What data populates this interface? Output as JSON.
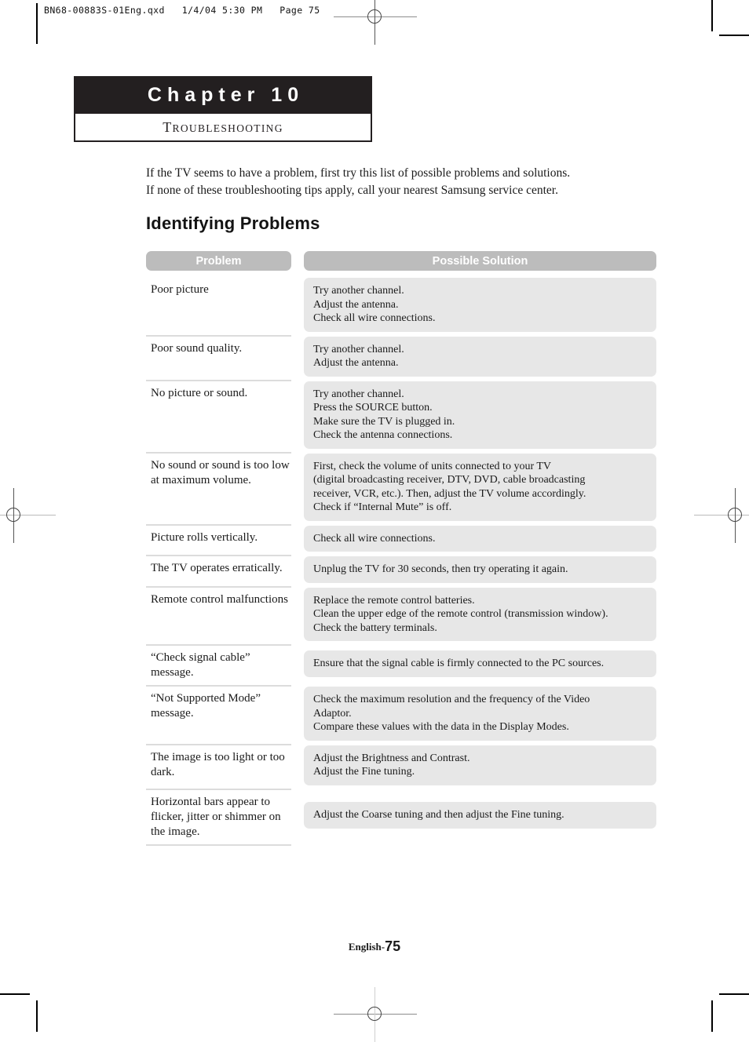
{
  "print_header": {
    "text": "BN68-00883S-01Eng.qxd   1/4/04 5:30 PM   Page 75"
  },
  "chapter": {
    "title": "Chapter 10",
    "subtitle_first_letter": "T",
    "subtitle_rest": "ROUBLESHOOTING"
  },
  "intro": {
    "line1": "If the TV seems to have a problem, first try this list of possible problems and solutions.",
    "line2": "If none of these troubleshooting tips apply, call your nearest Samsung service center."
  },
  "section": {
    "heading": "Identifying Problems"
  },
  "table": {
    "headers": {
      "problem": "Problem",
      "solution": "Possible Solution"
    },
    "rows": [
      {
        "problem": "Poor picture",
        "solution": [
          "Try another channel.",
          "Adjust the antenna.",
          "Check all wire connections."
        ]
      },
      {
        "problem": "Poor sound quality.",
        "solution": [
          "Try another channel.",
          "Adjust the antenna."
        ]
      },
      {
        "problem": "No picture or sound.",
        "solution": [
          "Try another channel.",
          "Press the SOURCE button.",
          "Make sure the TV is plugged in.",
          "Check the antenna connections."
        ]
      },
      {
        "problem": "No sound or sound is too low at maximum volume.",
        "solution": [
          "First, check the volume of units connected to your TV",
          "(digital broadcasting receiver, DTV, DVD, cable broadcasting",
          "receiver, VCR, etc.). Then, adjust the TV volume accordingly.",
          "Check if “Internal Mute” is off."
        ]
      },
      {
        "problem": "Picture rolls vertically.",
        "solution": [
          "Check all wire connections."
        ]
      },
      {
        "problem": "The TV operates erratically.",
        "solution": [
          "Unplug the TV for 30 seconds, then try operating it again."
        ]
      },
      {
        "problem": "Remote control malfunctions",
        "solution": [
          "Replace the remote control batteries.",
          "Clean the upper edge of the remote control (transmission window).",
          "Check the battery terminals."
        ]
      },
      {
        "problem": "“Check signal cable” message.",
        "solution": [
          "Ensure that the signal cable is firmly connected to the PC sources."
        ]
      },
      {
        "problem": "“Not Supported Mode” message.",
        "solution": [
          "Check the maximum resolution and the frequency of the Video",
          "Adaptor.",
          "Compare these values with the data in the Display Modes."
        ]
      },
      {
        "problem": "The image is too light or too dark.",
        "solution": [
          "Adjust the Brightness and Contrast.",
          "Adjust the Fine tuning."
        ]
      },
      {
        "problem": "Horizontal bars appear to flicker, jitter or shimmer on the image.",
        "solution": [
          "Adjust the Coarse tuning and then adjust the Fine tuning."
        ]
      }
    ]
  },
  "footer": {
    "language": "English-",
    "page_number": "75"
  },
  "colors": {
    "header_bar": "#bcbcbc",
    "solution_box": "#e7e7e7",
    "chapter_bar": "#231f20",
    "divider": "#dcdcdc"
  }
}
